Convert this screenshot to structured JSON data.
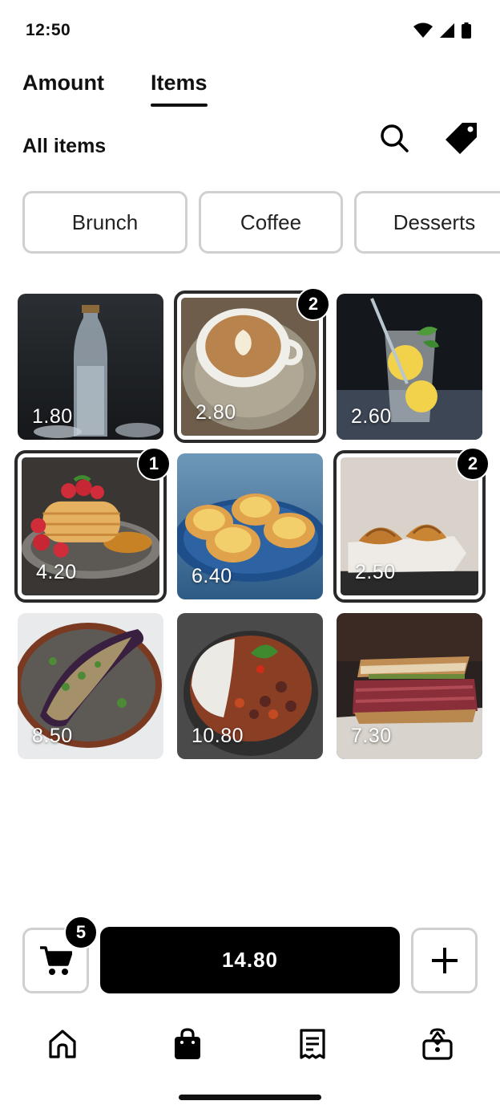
{
  "status_bar": {
    "time": "12:50"
  },
  "tabs": [
    {
      "label": "Amount",
      "active": false
    },
    {
      "label": "Items",
      "active": true
    }
  ],
  "section": {
    "title": "All items"
  },
  "categories": [
    "Brunch",
    "Coffee",
    "Desserts"
  ],
  "items": [
    {
      "price": "1.80",
      "image": "sparkling-water-bottle",
      "count": null
    },
    {
      "price": "2.80",
      "image": "latte-cup",
      "count": "2"
    },
    {
      "price": "2.60",
      "image": "lemonade-glass",
      "count": null
    },
    {
      "price": "4.20",
      "image": "pancakes-with-berries",
      "count": "1"
    },
    {
      "price": "6.40",
      "image": "egg-tarts",
      "count": null
    },
    {
      "price": "2.50",
      "image": "croissants",
      "count": "2"
    },
    {
      "price": "8.50",
      "image": "stuffed-eggplant",
      "count": null
    },
    {
      "price": "10.80",
      "image": "rice-and-beans-bowl",
      "count": null
    },
    {
      "price": "7.30",
      "image": "pastrami-sandwich",
      "count": null
    }
  ],
  "cart": {
    "count": "5"
  },
  "total": {
    "label": "14.80"
  },
  "nav": [
    "home-icon",
    "shopping-bag-icon",
    "receipt-icon",
    "box-icon"
  ],
  "colors": {
    "primary": "#000000",
    "chip_border": "#d0d0d0",
    "background": "#ffffff"
  }
}
